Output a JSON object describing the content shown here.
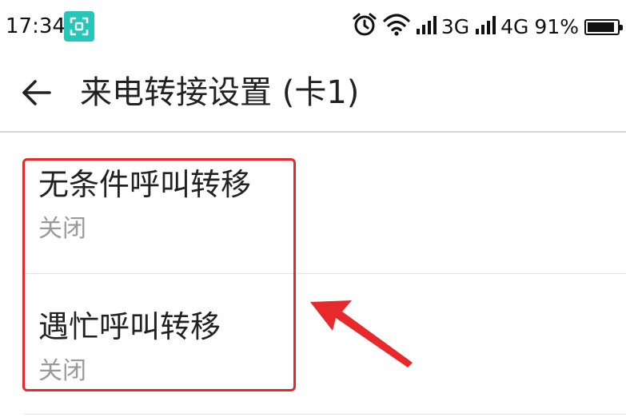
{
  "status_bar": {
    "time": "17:34",
    "network_1": "3G",
    "network_2": "4G",
    "battery_percent": "91%",
    "battery_level": 0.91,
    "icons": [
      "scan-icon",
      "alarm-clock-icon",
      "wifi-icon",
      "signal-bars-icon",
      "signal-bars-icon",
      "battery-icon"
    ],
    "scan_badge_color": "#25c7b9"
  },
  "header": {
    "back_icon": "back-arrow-icon",
    "title": "来电转接设置 (卡1)"
  },
  "settings": {
    "items": [
      {
        "title": "无条件呼叫转移",
        "status": "关闭"
      },
      {
        "title": "遇忙呼叫转移",
        "status": "关闭"
      }
    ]
  },
  "annotation": {
    "color": "#e8292b"
  }
}
